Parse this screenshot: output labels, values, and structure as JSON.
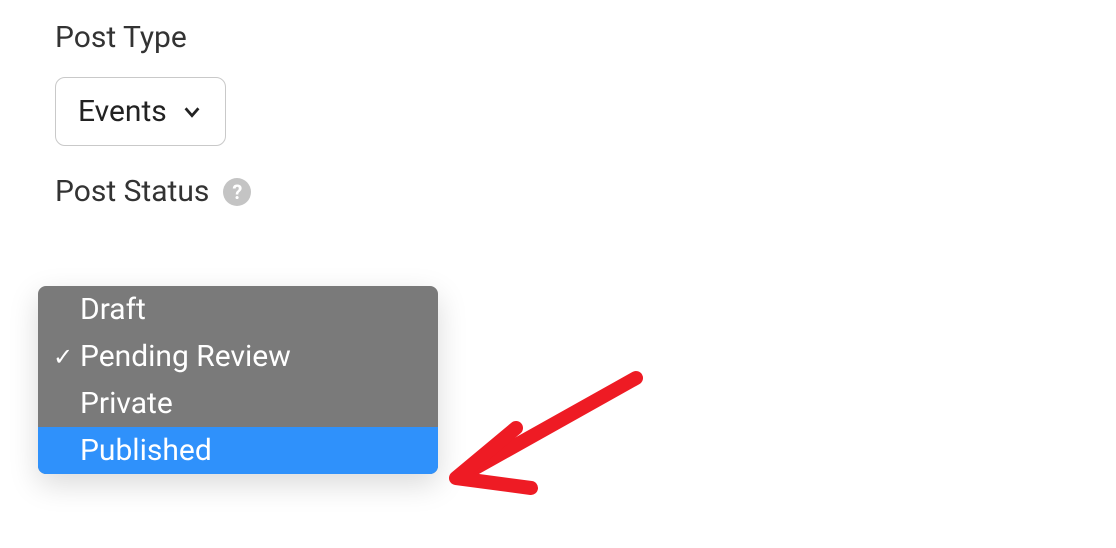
{
  "postType": {
    "label": "Post Type",
    "selected": "Events"
  },
  "postStatus": {
    "label": "Post Status",
    "selected": "Pending Review",
    "options": [
      {
        "label": "Draft",
        "checked": false,
        "highlighted": false
      },
      {
        "label": "Pending Review",
        "checked": true,
        "highlighted": false
      },
      {
        "label": "Private",
        "checked": false,
        "highlighted": false
      },
      {
        "label": "Published",
        "checked": false,
        "highlighted": true
      }
    ]
  },
  "annotation": {
    "color": "#ee1b24"
  }
}
